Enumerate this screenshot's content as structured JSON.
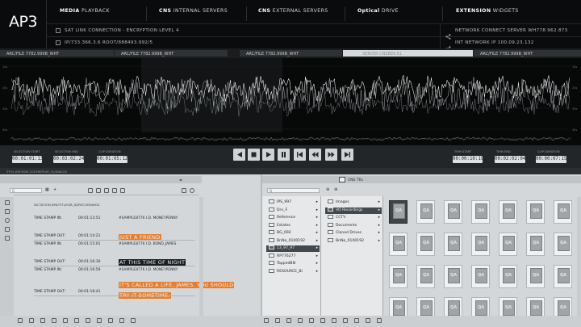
{
  "app": {
    "logo": "AP3"
  },
  "nav": [
    {
      "bold": "MEDIA",
      "rest": "PLAYBACK"
    },
    {
      "bold": "CNS",
      "rest": "INTERNAL SERVERS"
    },
    {
      "bold": "CNS",
      "rest": "EXTERNAL SERVERS"
    },
    {
      "bold": "Optical",
      "rest": "DRIVE"
    },
    {
      "bold": "EXTENSION",
      "rest": "WIDGETS"
    }
  ],
  "status": {
    "sat_link": "SAT LINK CONNECTION - ENCRYPTION LEVEL 4",
    "ip": "IP/733.366.3.6    ROOT/888493.992/5",
    "network_connect": "NETWORK CONNECT SERVER WH778.962.873",
    "int_network": "INT NETWORK IP 100.09.23.132"
  },
  "tabs": [
    {
      "label": "ARC/FILE 7782.999B_WHT",
      "active": false
    },
    {
      "label": "ARC/FILE 7782.999B_WHT",
      "active": false
    },
    {
      "label": "SERVER CNS889.61",
      "active": true
    },
    {
      "label": "ARC/FILE 7782.999B_WHT",
      "active": false
    }
  ],
  "transport": {
    "selection_start_label": "SELECTION START",
    "selection_start": "00:01:01:13",
    "selection_end_label": "SELECTION END",
    "selection_end": "00:03:02:24",
    "clip_duration_label": "CLIP DURATION",
    "clip_duration": "00:01:05:12",
    "trim_start_label": "TRIM START",
    "trim_start": "00:00:10:19",
    "trim_end_label": "TRIM END",
    "trim_end": "00:02:02:04",
    "clip_duration2_label": "CLIP DURATION",
    "clip_duration2": "00:00:07:15"
  },
  "strip": {
    "path": "ZP15.ARCHIVE.2023REPLAY_01/DIALOG"
  },
  "dictation": {
    "title": "DICTATION JMN/TITLES/B_ID/RECORDINGS",
    "search_placeholder": "Q",
    "entries": [
      {
        "label": "TIME STAMP IN:",
        "time": "00:01:13:51",
        "meta": "#SAMPLE8776   I.D.  MONEYPENNY",
        "quote": "JUST A FRIEND",
        "style": "orange"
      },
      {
        "label": "TIME STAMP OUT:",
        "time": "00:01:14:21"
      },
      {
        "label": "TIME STAMP IN:",
        "time": "00:01:15:01",
        "meta": "#SAMPLE8776   I.D.  BOND_JAMES",
        "quote": "AT THIS TIME OF NIGHT",
        "style": "dark"
      },
      {
        "label": "TIME STAMP OUT:",
        "time": "00:01:16:30"
      },
      {
        "label": "TIME STAMP IN:",
        "time": "00:01:16:59",
        "meta": "#SAMPLE8776   I.D.  MONEYPENNY",
        "quote": "IT'S CALLED A LIFE, JAMES. YOU SHOULD TRY IT SOMETIME.",
        "style": "orange"
      },
      {
        "label": "TIME STAMP OUT:",
        "time": "00:01:18:41"
      }
    ]
  },
  "browser": {
    "title": "CNS TRs",
    "col1": [
      "IPS_997",
      "Drv_F",
      "Reference",
      "Estates",
      "BG_092",
      "BnNo_0100192",
      "13_97_97",
      "RP776277",
      "TappedBN",
      "RESOURCE_Bi"
    ],
    "col1_selected": "13_97_97",
    "col2": [
      "Images",
      "VO Recordings",
      "CCTV",
      "Documents",
      "Cloned Drives",
      "BnNo_0100192"
    ],
    "col2_selected": "VO Recordings",
    "thumb_label": "QA"
  },
  "colors": {
    "accent": "#e67e2e",
    "panel": "#d4d7d9",
    "header": "#0a0b0c"
  }
}
